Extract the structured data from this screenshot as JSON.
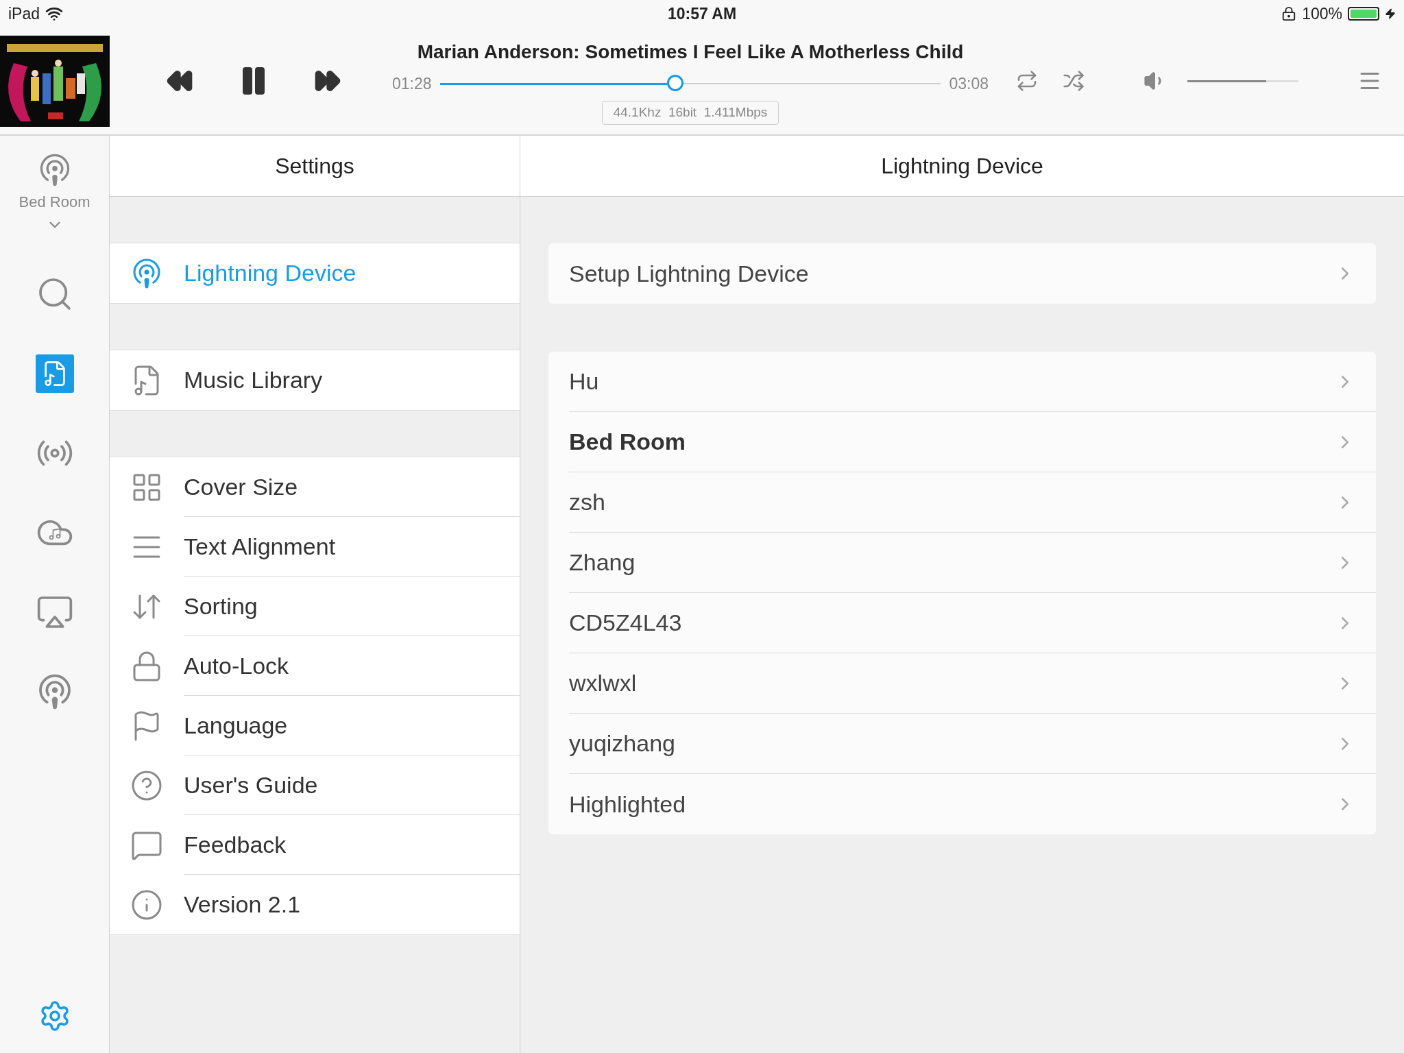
{
  "status_bar": {
    "device": "iPad",
    "time": "10:57 AM",
    "battery": "100%"
  },
  "player": {
    "title": "Marian Anderson: Sometimes I Feel Like A Motherless Child",
    "playing": true,
    "elapsed": "01:28",
    "duration": "03:08",
    "progress": {
      "level": 0.47
    },
    "format": "44.1Khz  16bit  1.411Mbps",
    "volume": {
      "level": 0.71
    }
  },
  "rail": {
    "zone": "Bed Room",
    "items": [
      {
        "kind": "search",
        "selected": false
      },
      {
        "kind": "library",
        "selected": true
      },
      {
        "kind": "radio",
        "selected": false
      },
      {
        "kind": "cloud",
        "selected": false
      },
      {
        "kind": "airplay",
        "selected": false
      },
      {
        "kind": "wireless",
        "selected": false
      }
    ],
    "settings_selected": true
  },
  "settings": {
    "title": "Settings",
    "groups": [
      [
        {
          "kind": "antenna",
          "label": "Lightning Device",
          "selected": true
        }
      ],
      [
        {
          "kind": "library",
          "label": "Music Library",
          "selected": false
        }
      ],
      [
        {
          "kind": "grid",
          "label": "Cover Size",
          "selected": false
        },
        {
          "kind": "lines",
          "label": "Text Alignment",
          "selected": false
        },
        {
          "kind": "sort",
          "label": "Sorting",
          "selected": false
        },
        {
          "kind": "lock",
          "label": "Auto-Lock",
          "selected": false
        },
        {
          "kind": "flag",
          "label": "Language",
          "selected": false
        },
        {
          "kind": "help",
          "label": "User's Guide",
          "selected": false
        },
        {
          "kind": "chat",
          "label": "Feedback",
          "selected": false
        },
        {
          "kind": "info",
          "label": "Version 2.1",
          "selected": false
        }
      ]
    ]
  },
  "detail": {
    "title": "Lightning Device",
    "setup": "Setup Lightning Device",
    "devices": [
      {
        "name": "Hu",
        "selected": false
      },
      {
        "name": "Bed Room",
        "selected": true
      },
      {
        "name": "zsh",
        "selected": false
      },
      {
        "name": "Zhang",
        "selected": false
      },
      {
        "name": "CD5Z4L43",
        "selected": false
      },
      {
        "name": "wxlwxl",
        "selected": false
      },
      {
        "name": "yuqizhang",
        "selected": false
      },
      {
        "name": "Highlighted",
        "selected": false
      }
    ]
  }
}
